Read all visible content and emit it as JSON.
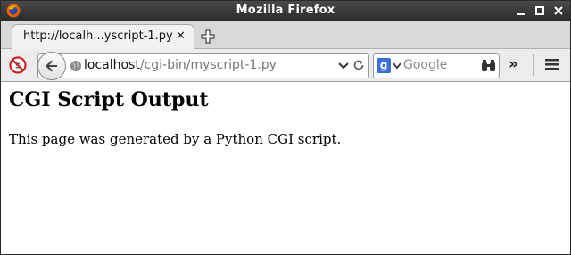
{
  "window": {
    "title": "Mozilla Firefox"
  },
  "tabs": [
    {
      "label": "http://localh...yscript-1.py",
      "active": true
    }
  ],
  "navbar": {
    "url_host": "localhost",
    "url_path": "/cgi-bin/myscript-1.py",
    "search_placeholder": "Google",
    "search_engine_letter": "g"
  },
  "icons": {
    "app": "firefox-icon",
    "back": "back-arrow-icon",
    "site": "globe-icon",
    "reload": "reload-icon",
    "search": "binoculars-icon",
    "overflow": "chevron-double-right-icon",
    "menu": "hamburger-menu-icon"
  },
  "colors": {
    "titlebar": "#2b2b2b",
    "google_badge": "#3a6fd8"
  },
  "page": {
    "heading": "CGI Script Output",
    "paragraph": "This page was generated by a Python CGI script."
  }
}
